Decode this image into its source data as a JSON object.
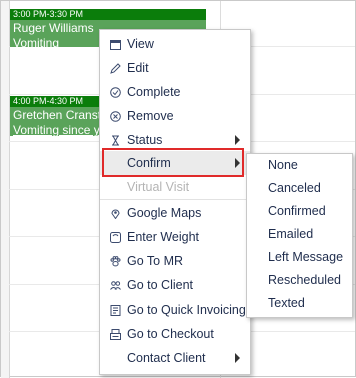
{
  "calendar": {
    "appointments": [
      {
        "time": "3:00 PM-3:30 PM",
        "name": "Ruger Williams",
        "reason": "Vomiting"
      },
      {
        "time": "4:00 PM-4:30 PM",
        "name": "Gretchen Cranston",
        "reason": "Vomiting since y"
      }
    ]
  },
  "context_menu": {
    "items": [
      {
        "label": "View",
        "icon": "calendar-icon"
      },
      {
        "label": "Edit",
        "icon": "pencil-icon"
      },
      {
        "label": "Complete",
        "icon": "check-circle-icon"
      },
      {
        "label": "Remove",
        "icon": "x-circle-icon"
      },
      {
        "label": "Status",
        "icon": "hourglass-icon",
        "has_submenu": true
      },
      {
        "label": "Confirm",
        "icon": "",
        "has_submenu": true,
        "highlighted": true
      },
      {
        "label": "Virtual Visit",
        "icon": "",
        "disabled": true
      },
      {
        "label": "Google Maps",
        "icon": "map-pin-icon"
      },
      {
        "label": "Enter Weight",
        "icon": "scale-icon"
      },
      {
        "label": "Go To MR",
        "icon": "paw-icon"
      },
      {
        "label": "Go to Client",
        "icon": "users-icon"
      },
      {
        "label": "Go to Quick Invoicing",
        "icon": "invoice-icon"
      },
      {
        "label": "Go to Checkout",
        "icon": "register-icon"
      },
      {
        "label": "Contact Client",
        "icon": "",
        "has_submenu": true
      }
    ]
  },
  "confirm_submenu": {
    "items": [
      "None",
      "Canceled",
      "Confirmed",
      "Emailed",
      "Left Message",
      "Rescheduled",
      "Texted"
    ]
  },
  "colors": {
    "appointment_bg": "#5aa35a",
    "appointment_time_bg": "#0b7d0b",
    "highlight_border": "#e02a2a",
    "menu_text": "#1f2d4d"
  }
}
